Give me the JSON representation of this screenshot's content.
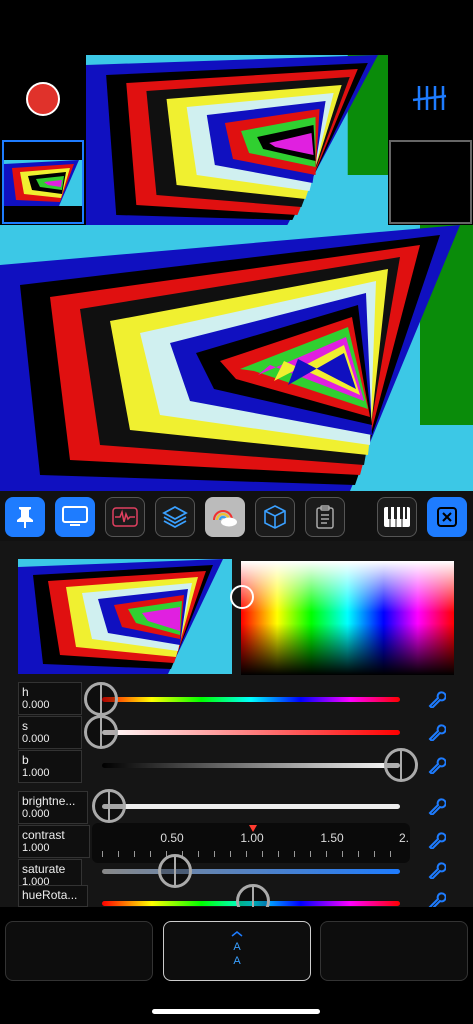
{
  "top": {
    "record_button": "record-icon",
    "tally_icon": "tally-marks-icon"
  },
  "toolbar": {
    "items": [
      {
        "icon": "pin-icon",
        "state": "active"
      },
      {
        "icon": "monitor-icon",
        "state": "active"
      },
      {
        "icon": "waveform-icon",
        "state": "normal"
      },
      {
        "icon": "layers-icon",
        "state": "normal"
      },
      {
        "icon": "rainbow-cloud-icon",
        "state": "selected"
      },
      {
        "icon": "cube-icon",
        "state": "normal"
      },
      {
        "icon": "clipboard-icon",
        "state": "normal"
      },
      {
        "icon": "piano-keys-icon",
        "state": "normal"
      },
      {
        "icon": "close-box-icon",
        "state": "active"
      }
    ]
  },
  "sliders": [
    {
      "name": "h",
      "value": "0.000",
      "fraction": 0.0
    },
    {
      "name": "s",
      "value": "0.000",
      "fraction": 0.0
    },
    {
      "name": "b",
      "value": "1.000",
      "fraction": 1.0
    },
    {
      "name": "brightne...",
      "value": "0.000",
      "fraction": 0.0
    },
    {
      "name": "contrast",
      "value": "1.000"
    },
    {
      "name": "saturate",
      "value": "1.000",
      "fraction": 0.25
    },
    {
      "name": "hueRota...",
      "value": "",
      "fraction": 0.5
    }
  ],
  "ruler": {
    "labels": [
      "0.50",
      "1.00",
      "1.50",
      "2."
    ]
  },
  "bottom": {
    "center_label_1": "A",
    "center_label_2": "A",
    "accent": "#1e7cff"
  }
}
